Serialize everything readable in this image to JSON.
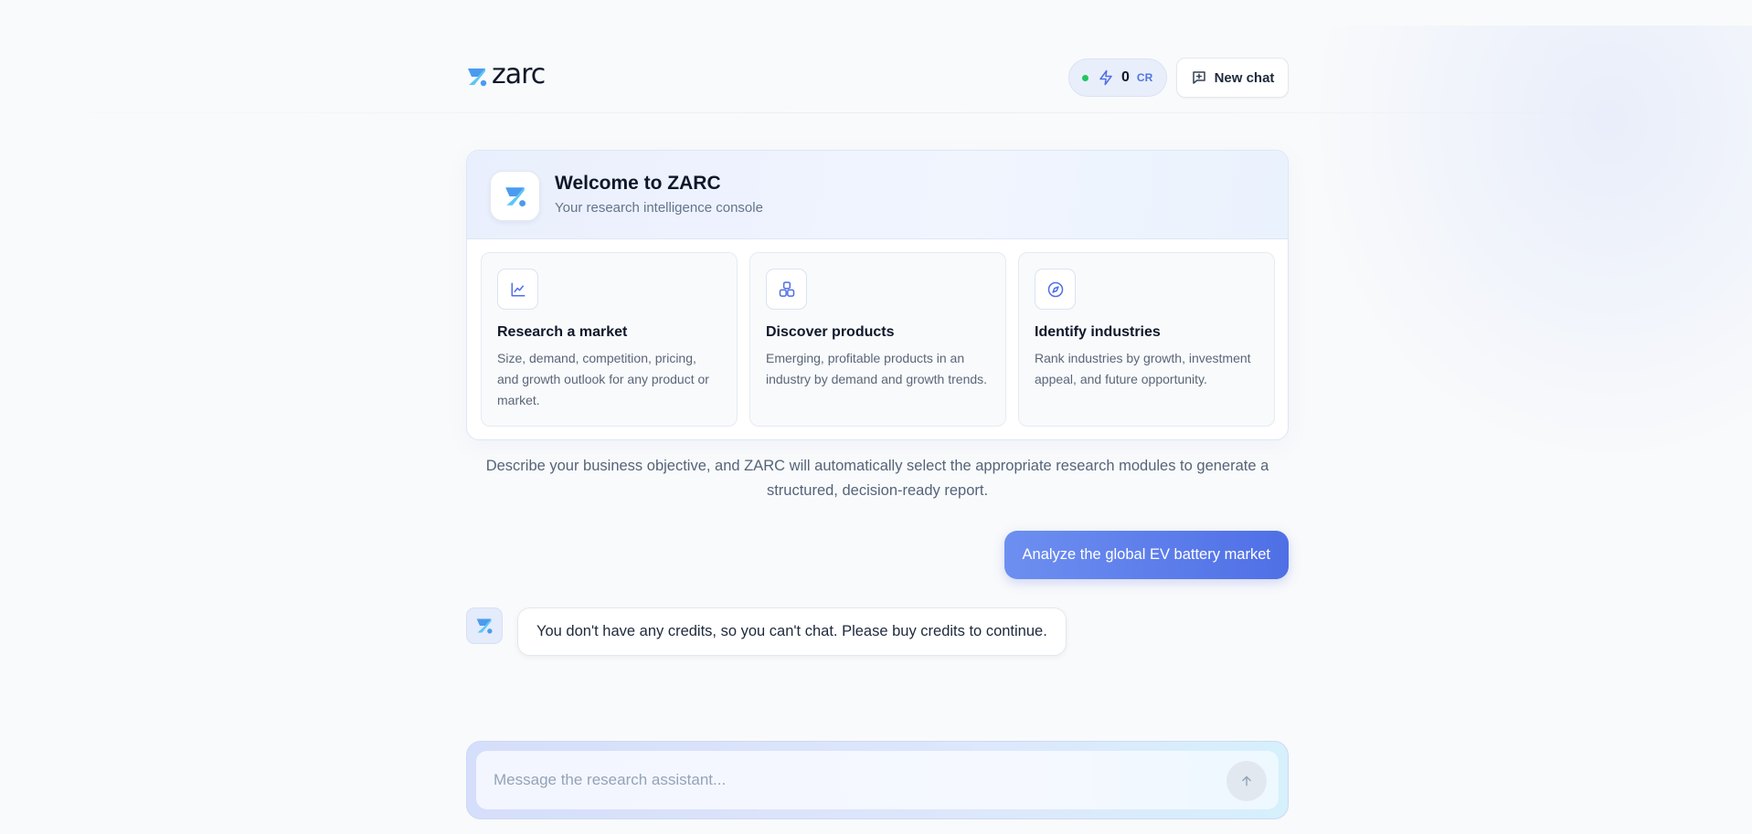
{
  "brand": {
    "name": "zarc"
  },
  "header": {
    "credits_value": "0",
    "credits_unit": "CR",
    "new_chat_label": "New chat"
  },
  "welcome": {
    "title": "Welcome to ZARC",
    "subtitle": "Your research intelligence console",
    "features": [
      {
        "icon": "line-chart-icon",
        "title": "Research a market",
        "description": "Size, demand, competition, pricing, and growth outlook for any product or market."
      },
      {
        "icon": "boxes-icon",
        "title": "Discover products",
        "description": "Emerging, profitable products in an industry by demand and growth trends."
      },
      {
        "icon": "compass-icon",
        "title": "Identify industries",
        "description": "Rank industries by growth, investment appeal, and future opportunity."
      }
    ]
  },
  "description": "Describe your business objective, and ZARC will automatically select the appropriate research modules to generate a structured, decision-ready report.",
  "chat": {
    "user_message": "Analyze the global EV battery market",
    "assistant_message": "You don't have any credits, so you can't chat. Please buy credits to continue."
  },
  "composer": {
    "placeholder": "Message the research assistant...",
    "value": ""
  },
  "colors": {
    "accent": "#4f6fe6",
    "status_green": "#22c55e",
    "logo_blue": "#3b82f6",
    "logo_cyan": "#38bdf8"
  }
}
